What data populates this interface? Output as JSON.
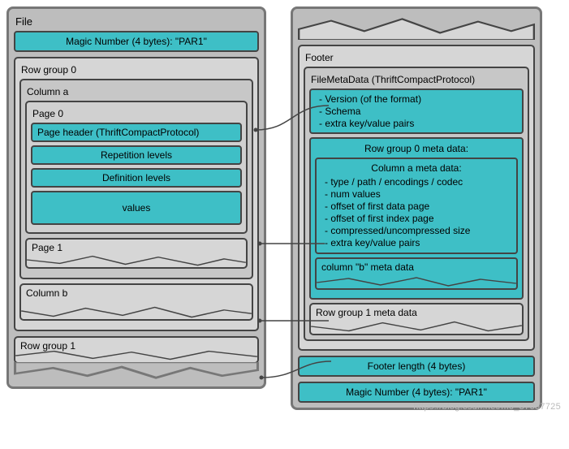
{
  "watermark": "https://blog.csdn.net/m0_37657725",
  "file": {
    "title": "File",
    "magic": "Magic Number (4 bytes): \"PAR1\"",
    "rowgroup0": {
      "title": "Row group 0",
      "columnA": {
        "title": "Column a",
        "page0": {
          "title": "Page 0",
          "header": "Page header (ThriftCompactProtocol)",
          "rep": "Repetition levels",
          "def": "Definition levels",
          "values": "values"
        },
        "page1": "Page 1"
      },
      "columnB": "Column b"
    },
    "rowgroup1": "Row group 1"
  },
  "footer": {
    "title": "Footer",
    "fileMeta": {
      "title": "FileMetaData (ThriftCompactProtocol)",
      "items": {
        "v": "Version (of the format)",
        "s": "Schema",
        "e": "extra key/value pairs"
      },
      "rg0meta": {
        "title": "Row group 0 meta data:",
        "colA": {
          "title": "Column a meta data:",
          "l1": "type / path / encodings / codec",
          "l2": "num values",
          "l3": "offset of first data page",
          "l4": "offset of first index page",
          "l5": "compressed/uncompressed size",
          "l6": "extra key/value pairs"
        },
        "colB": "column \"b\" meta data"
      },
      "rg1meta": "Row group 1 meta data"
    },
    "footerLen": "Footer length (4 bytes)",
    "magic": "Magic Number (4 bytes): \"PAR1\""
  }
}
